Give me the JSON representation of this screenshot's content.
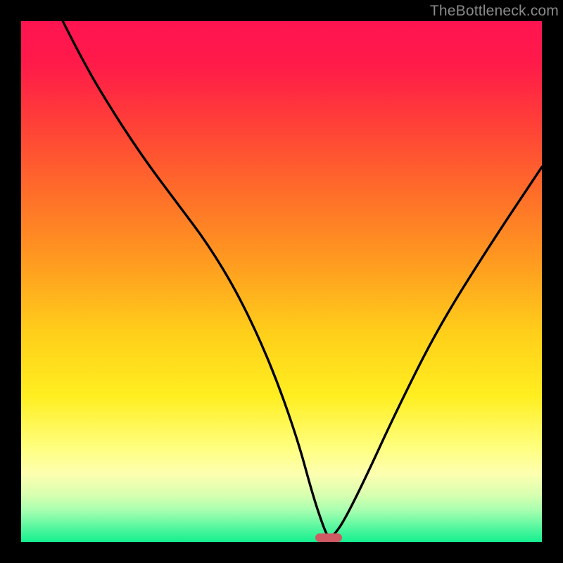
{
  "watermark": "TheBottleneck.com",
  "colors": {
    "frame_bg": "#000000",
    "curve_stroke": "#000000",
    "marker_fill": "#cf5a64",
    "watermark_text": "#8a8a8a",
    "gradient_stops": [
      "#ff1450",
      "#ff1a4a",
      "#ff3a3a",
      "#ff6a2a",
      "#ff9a20",
      "#ffcf1a",
      "#ffee20",
      "#ffff80",
      "#fdffb0",
      "#d8ffb0",
      "#a6ffb0",
      "#5cf7a0",
      "#15f090"
    ]
  },
  "chart_data": {
    "type": "line",
    "title": "",
    "xlabel": "",
    "ylabel": "",
    "xlim": [
      0,
      100
    ],
    "ylim": [
      0,
      100
    ],
    "grid": false,
    "legend": false,
    "comment": "x = horizontal position 0..100 left→right, y = value 0 at bottom to 100 at top. Single black curve with a deep valley near x≈59 and a small rounded marker at the minimum.",
    "series": [
      {
        "name": "curve",
        "x": [
          8,
          12,
          18,
          24,
          30,
          36,
          42,
          48,
          53,
          56,
          58,
          59,
          60,
          62,
          66,
          72,
          80,
          90,
          100
        ],
        "y": [
          100,
          92,
          82,
          73,
          65,
          57,
          47,
          34,
          20,
          9,
          3,
          0.8,
          1.2,
          4,
          12,
          25,
          41,
          57,
          72
        ]
      }
    ],
    "marker": {
      "x": 59,
      "y": 0.8,
      "shape": "pill"
    }
  }
}
